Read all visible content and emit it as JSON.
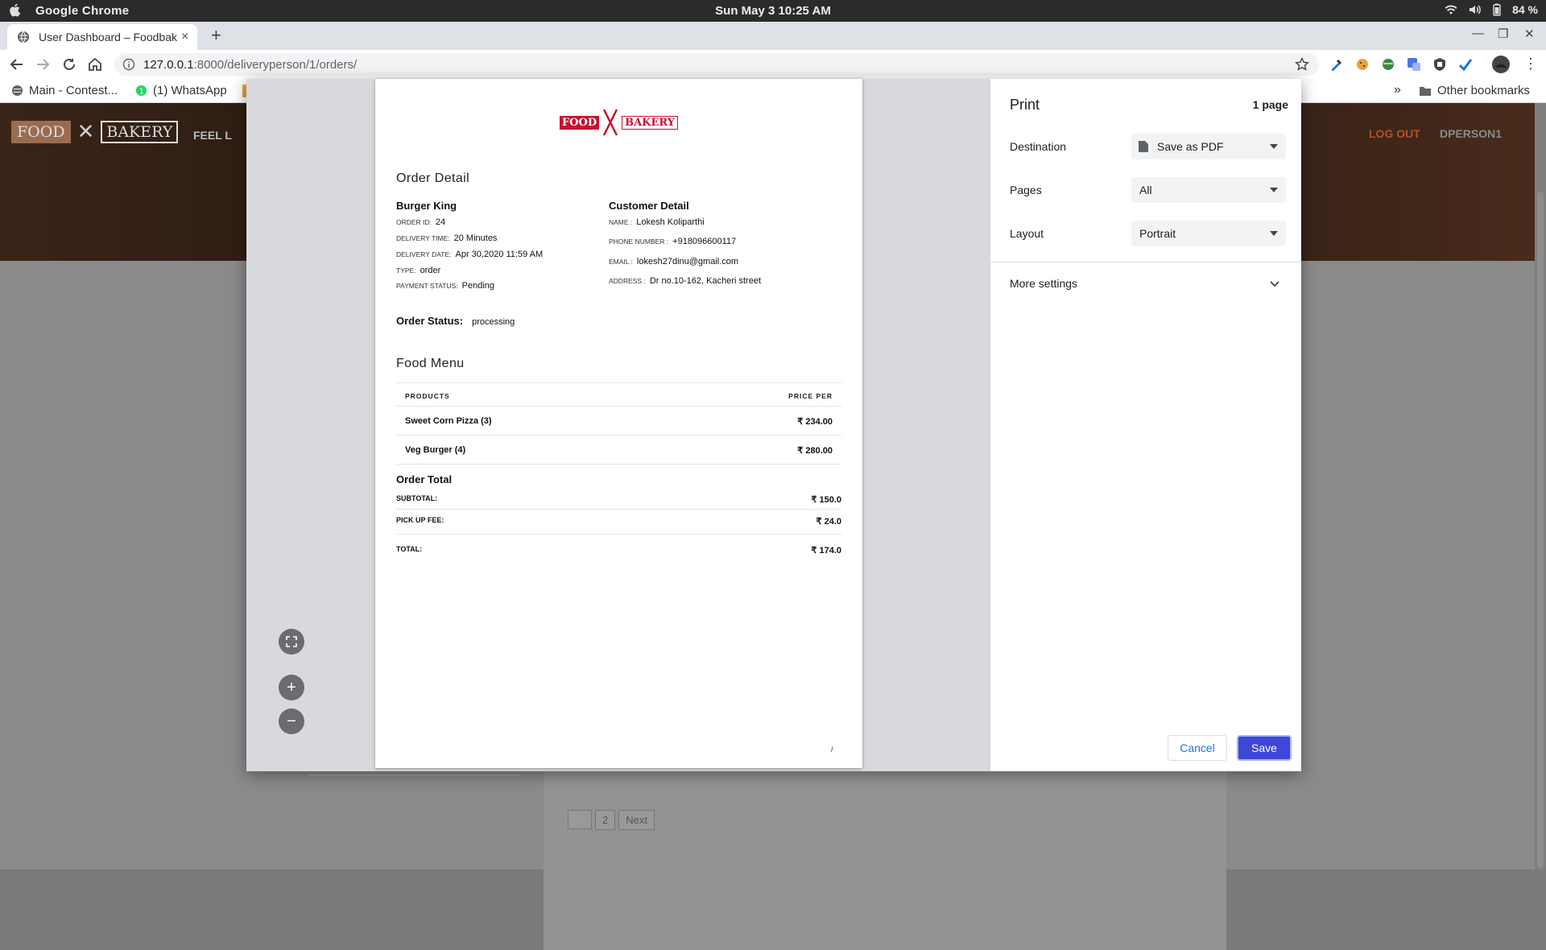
{
  "os": {
    "app_name": "Google Chrome",
    "clock": "Sun May 3  10:25 AM",
    "battery": "84 %"
  },
  "browser": {
    "tab_title": "User Dashboard – Foodbakery",
    "tab_close": "×",
    "new_tab": "+",
    "url_host": "127.0.0.1",
    "url_path": ":8000/deliveryperson/1/orders/",
    "bookmarks": [
      "Main - Contest...",
      "(1) WhatsApp"
    ],
    "bookmarks_more": "»",
    "other_bookmarks": "Other bookmarks"
  },
  "site": {
    "logo_left": "FOOD",
    "logo_right": "BAKERY",
    "feel": "FEEL L",
    "logout": "LOG OUT",
    "user": "DPERSON1",
    "pager": [
      "",
      "2",
      "Next"
    ]
  },
  "print": {
    "title": "Print",
    "pages_count": "1 page",
    "destination_label": "Destination",
    "destination_value": "Save as PDF",
    "pages_label": "Pages",
    "pages_value": "All",
    "layout_label": "Layout",
    "layout_value": "Portrait",
    "more_settings": "More settings",
    "cancel": "Cancel",
    "save": "Save"
  },
  "sheet": {
    "logo_food": "FOOD",
    "logo_bakery": "BAKERY",
    "order_detail_title": "Order Detail",
    "restaurant": "Burger King",
    "order_id_label": "ORDER ID:",
    "order_id": "24",
    "delivery_time_label": "DELIVERY TIME:",
    "delivery_time": "20 Minutes",
    "delivery_date_label": "DELIVERY DATE:",
    "delivery_date": "Apr 30,2020 11:59 AM",
    "type_label": "TYPE:",
    "type": "order",
    "payment_status_label": "PAYMENT STATUS:",
    "payment_status": "Pending",
    "customer_title": "Customer Detail",
    "name_label": "NAME :",
    "name": "Lokesh Koliparthi",
    "phone_label": "PHONE NUMBER :",
    "phone": "+918096600117",
    "email_label": "EMAIL :",
    "email": "lokesh27dinu@gmail.com",
    "address_label": "ADDRESS :",
    "address": "Dr no.10-162, Kacheri street",
    "order_status_label": "Order Status:",
    "order_status": "processing",
    "food_menu_title": "Food Menu",
    "col_products": "PRODUCTS",
    "col_price": "PRICE PER",
    "items": [
      {
        "name": "Sweet Corn Pizza (3)",
        "price": "₹ 234.00"
      },
      {
        "name": "Veg Burger (4)",
        "price": "₹ 280.00"
      }
    ],
    "order_total_title": "Order Total",
    "subtotal_label": "SUBTOTAL:",
    "subtotal": "₹ 150.0",
    "pickup_label": "PICK UP FEE:",
    "pickup": "₹ 24.0",
    "total_label": "TOTAL:",
    "total": "₹ 174.0",
    "footer_mark": "/"
  },
  "colors": {
    "brand_red": "#c8102e",
    "save_button": "#3d47d8",
    "link_blue": "#1a73e8"
  },
  "icons": [
    "apple-icon",
    "wifi-icon",
    "volume-icon",
    "battery-icon",
    "back-icon",
    "forward-icon",
    "reload-icon",
    "home-icon",
    "info-icon",
    "star-icon",
    "document-icon",
    "chevron-down-icon",
    "fit-page-icon",
    "zoom-in-icon",
    "zoom-out-icon",
    "folder-icon"
  ]
}
